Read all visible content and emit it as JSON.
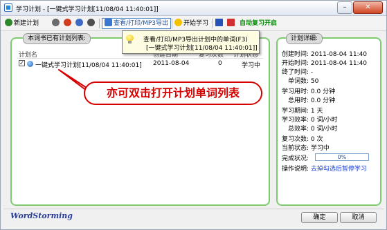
{
  "window": {
    "title": "学习计划 - [一键式学习计划[11/08/04 11:40:01]]",
    "minimize_label": "–",
    "close_label": "✕"
  },
  "toolbar": {
    "new_plan_label": "新建计划",
    "view_print_label": "查看/打印/MP3导出",
    "start_study_label": "开始学习",
    "auto_review_label": "自动复习开启",
    "icons": [
      "plus-icon",
      "edit-icon",
      "delete-icon",
      "settings-icon",
      "book-icon",
      "bulb-icon",
      "flag-icon",
      "flag-icon"
    ]
  },
  "left_panel": {
    "group_label": "本词书已有计划列表:",
    "columns": [
      "计划名",
      "创建日期",
      "复习次数",
      "计划状态"
    ],
    "rows": [
      {
        "checked": true,
        "name": "一键式学习计划[11/08/04 11:40:01]",
        "created": "2011-08-04",
        "reviews": "0",
        "status": "学习中"
      }
    ]
  },
  "tooltip": {
    "line1": "查看/打印/MP3导出计划中的单词(F3)",
    "line2": "[一键式学习计划[11/08/04 11:40:01]]"
  },
  "callout": {
    "text": "亦可双击打开计划单词列表",
    "color": "#d70000"
  },
  "right_panel": {
    "group_label": "计划详细:",
    "rows": [
      {
        "label": "创建时间:",
        "value": "2011-08-04 11:40"
      },
      {
        "label": "开始时间:",
        "value": "2011-08-04 11:40"
      },
      {
        "label": "终了时间:",
        "value": "-"
      },
      {
        "label": "单词数:",
        "value": "50"
      },
      {
        "label": "学习用时:",
        "value": "0.0 分钟"
      },
      {
        "label": "总用时:",
        "value": "0.0 分钟"
      },
      {
        "label": "学习期间:",
        "value": "1 天"
      },
      {
        "label": "学习效率:",
        "value": "0 词/小时"
      },
      {
        "label": "总效率:",
        "value": "0 词/小时"
      },
      {
        "label": "复习次数:",
        "value": "0 次"
      },
      {
        "label": "当前状态:",
        "value": "学习中"
      },
      {
        "label": "完成状况:",
        "value": ""
      },
      {
        "label": "操作说明:",
        "value": "去掉勾选后暂停学习"
      }
    ],
    "progress_percent": 0,
    "progress_text": "0%"
  },
  "footer": {
    "brand": "WordStorming",
    "ok_label": "确定",
    "cancel_label": "取消"
  },
  "colors": {
    "group_border": "#7ccc6e",
    "accent_blue": "#1e4d9c",
    "auto_review_green": "#0b8a0b"
  }
}
